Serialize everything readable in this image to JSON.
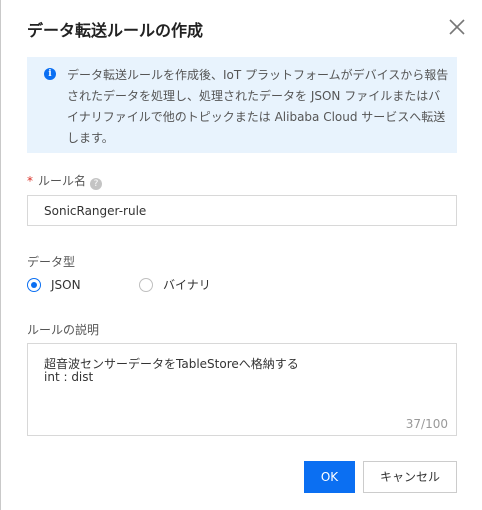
{
  "dialog": {
    "title": "データ転送ルールの作成",
    "close_icon": "close-icon"
  },
  "info": {
    "icon": "info-icon",
    "icon_glyph": "i",
    "text": "データ転送ルールを作成後、IoT プラットフォームがデバイスから報告されたデータを処理し、処理されたデータを JSON ファイルまたはバイナリファイルで他のトピックまたは Alibaba Cloud サービスへ転送します。",
    "background": "#e8f3fd",
    "accent": "#0b6ff2"
  },
  "rule_name": {
    "required_mark": "*",
    "label": "ルール名",
    "help_icon": "question-circle-icon",
    "help_glyph": "?",
    "value": "SonicRanger-rule"
  },
  "data_type": {
    "label": "データ型",
    "options": [
      {
        "label": "JSON",
        "selected": true
      },
      {
        "label": "バイナリ",
        "selected": false
      }
    ]
  },
  "description": {
    "label": "ルールの説明",
    "lines": [
      "超音波センサーデータをTableStoreへ格納する",
      "int : dist"
    ],
    "counter": "37/100"
  },
  "buttons": {
    "ok": "OK",
    "cancel": "キャンセル",
    "primary_color": "#0b6ff2"
  }
}
